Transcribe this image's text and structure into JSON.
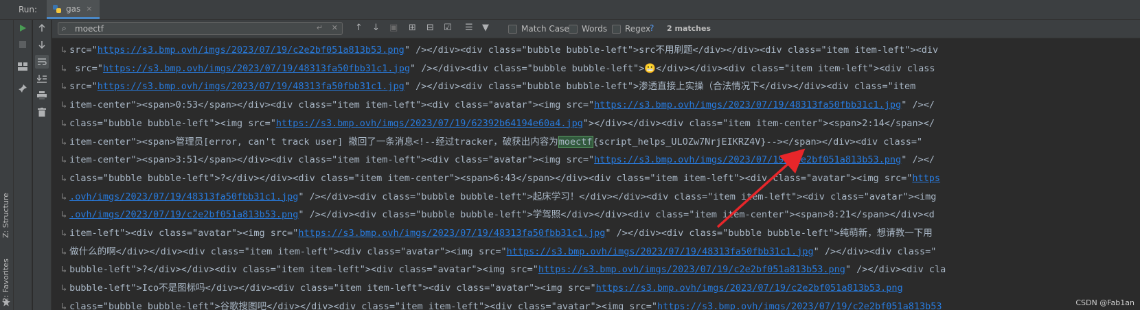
{
  "run_label": "Run:",
  "tab": {
    "name": "gas",
    "close": "×"
  },
  "side_labels": {
    "structure": "Z: Structure",
    "favorites": "2: Favorites"
  },
  "search": {
    "value": "moectf",
    "match_case": "Match Case",
    "words": "Words",
    "regex": "Regex",
    "help": "?",
    "matches": "2 matches"
  },
  "code_lines": [
    {
      "segments": [
        {
          "t": "src=\"",
          "c": "text"
        },
        {
          "t": "https://s3.bmp.ovh/imgs/2023/07/19/c2e2bf051a813b53.png",
          "c": "link"
        },
        {
          "t": "\" /></div><div class=\"bubble bubble-left\">src不用刷题</div></div><div class=\"item item-left\"><div",
          "c": "text"
        }
      ]
    },
    {
      "segments": [
        {
          "t": " src=\"",
          "c": "text"
        },
        {
          "t": "https://s3.bmp.ovh/imgs/2023/07/19/48313fa50fbb31c1.jpg",
          "c": "link"
        },
        {
          "t": "\" /></div><div class=\"bubble bubble-left\">😬</div></div><div class=\"item item-left\"><div class",
          "c": "text"
        }
      ]
    },
    {
      "segments": [
        {
          "t": "src=\"",
          "c": "text"
        },
        {
          "t": "https://s3.bmp.ovh/imgs/2023/07/19/48313fa50fbb31c1.jpg",
          "c": "link"
        },
        {
          "t": "\" /></div><div class=\"bubble bubble-left\">渗透直接上实操（合法情况下</div></div><div class=\"item",
          "c": "text"
        }
      ]
    },
    {
      "segments": [
        {
          "t": "item-center\"><span>0:53</span></div><div class=\"item item-left\"><div class=\"avatar\"><img src=\"",
          "c": "text"
        },
        {
          "t": "https://s3.bmp.ovh/imgs/2023/07/19/48313fa50fbb31c1.jpg",
          "c": "link"
        },
        {
          "t": "\" /></",
          "c": "text"
        }
      ]
    },
    {
      "segments": [
        {
          "t": "class=\"bubble bubble-left\"><img src=\"",
          "c": "text"
        },
        {
          "t": "https://s3.bmp.ovh/imgs/2023/07/19/62392b64194e60a4.jpg",
          "c": "link"
        },
        {
          "t": "\"></div></div><div class=\"item item-center\"><span>2:14</span></",
          "c": "text"
        }
      ]
    },
    {
      "segments": [
        {
          "t": "item-center\"><span>管理员[error, can't track user] 撤回了一条消息<!--经过tracker，破获出内容为",
          "c": "text"
        },
        {
          "t": "moectf",
          "c": "hl"
        },
        {
          "t": "{script_helps_ULOZw7NrjEIKRZ4V}--></span></div><div class=\"",
          "c": "text"
        }
      ]
    },
    {
      "segments": [
        {
          "t": "item-center\"><span>3:51</span></div><div class=\"item item-left\"><div class=\"avatar\"><img src=\"",
          "c": "text"
        },
        {
          "t": "https://s3.bmp.ovh/imgs/2023/07/19/c2e2bf051a813b53.png",
          "c": "link"
        },
        {
          "t": "\" /></",
          "c": "text"
        }
      ]
    },
    {
      "segments": [
        {
          "t": "class=\"bubble bubble-left\">?</div></div><div class=\"item item-center\"><span>6:43</span></div><div class=\"item item-left\"><div class=\"avatar\"><img src=\"",
          "c": "text"
        },
        {
          "t": "https",
          "c": "link"
        }
      ]
    },
    {
      "segments": [
        {
          "t": ".ovh/imgs/2023/07/19/48313fa50fbb31c1.jpg",
          "c": "link"
        },
        {
          "t": "\" /></div><div class=\"bubble bubble-left\">起床学习！</div></div><div class=\"item item-left\"><div class=\"avatar\"><img",
          "c": "text"
        }
      ]
    },
    {
      "segments": [
        {
          "t": ".ovh/imgs/2023/07/19/c2e2bf051a813b53.png",
          "c": "link"
        },
        {
          "t": "\" /></div><div class=\"bubble bubble-left\">学驾照</div></div><div class=\"item item-center\"><span>8:21</span></div><d",
          "c": "text"
        }
      ]
    },
    {
      "segments": [
        {
          "t": "item-left\"><div class=\"avatar\"><img src=\"",
          "c": "text"
        },
        {
          "t": "https://s3.bmp.ovh/imgs/2023/07/19/48313fa50fbb31c1.jpg",
          "c": "link"
        },
        {
          "t": "\" /></div><div class=\"bubble bubble-left\">纯萌新，想请教一下用",
          "c": "text"
        }
      ]
    },
    {
      "segments": [
        {
          "t": "做什么的啊</div></div><div class=\"item item-left\"><div class=\"avatar\"><img src=\"",
          "c": "text"
        },
        {
          "t": "https://s3.bmp.ovh/imgs/2023/07/19/48313fa50fbb31c1.jpg",
          "c": "link"
        },
        {
          "t": "\" /></div><div class=\"",
          "c": "text"
        }
      ]
    },
    {
      "segments": [
        {
          "t": "bubble-left\">?</div></div><div class=\"item item-left\"><div class=\"avatar\"><img src=\"",
          "c": "text"
        },
        {
          "t": "https://s3.bmp.ovh/imgs/2023/07/19/c2e2bf051a813b53.png",
          "c": "link"
        },
        {
          "t": "\" /></div><div cla",
          "c": "text"
        }
      ]
    },
    {
      "segments": [
        {
          "t": "bubble-left\">Ico不是图标吗</div></div><div class=\"item item-left\"><div class=\"avatar\"><img src=\"",
          "c": "text"
        },
        {
          "t": "https://s3.bmp.ovh/imgs/2023/07/19/c2e2bf051a813b53.png",
          "c": "link"
        }
      ]
    },
    {
      "segments": [
        {
          "t": "class=\"bubble bubble-left\">谷歌搜图吧</div></div><div class=\"item item-left\"><div class=\"avatar\"><img src=\"",
          "c": "text"
        },
        {
          "t": "https://s3.bmp.ovh/imgs/2023/07/19/c2e2bf051a813b53",
          "c": "link"
        }
      ]
    }
  ],
  "watermark": "CSDN @Fab1an",
  "colors": {
    "background": "#2b2b2b",
    "link": "#287bde",
    "highlight": "#32593d",
    "arrow": "#e8262a"
  }
}
